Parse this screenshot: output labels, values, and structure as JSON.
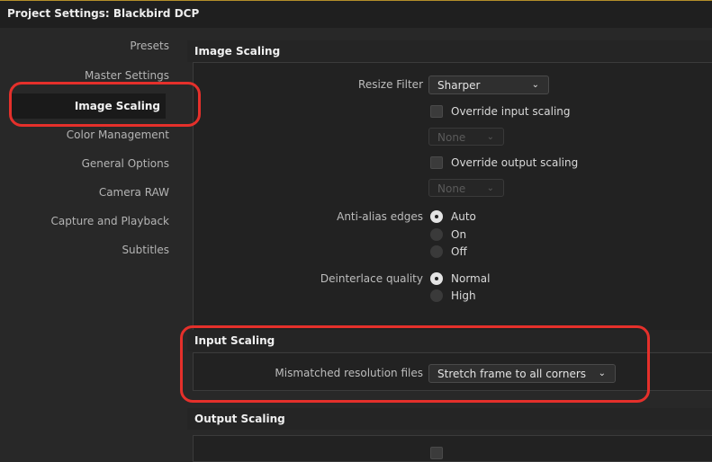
{
  "window": {
    "title": "Project Settings:  Blackbird DCP"
  },
  "sidebar": {
    "items": [
      {
        "label": "Presets"
      },
      {
        "label": "Master Settings"
      },
      {
        "label": "Image Scaling"
      },
      {
        "label": "Color Management"
      },
      {
        "label": "General Options"
      },
      {
        "label": "Camera RAW"
      },
      {
        "label": "Capture and Playback"
      },
      {
        "label": "Subtitles"
      }
    ],
    "active_index": 2
  },
  "image_scaling": {
    "header": "Image Scaling",
    "resize_filter_label": "Resize Filter",
    "resize_filter_value": "Sharper",
    "override_input_label": "Override input scaling",
    "override_input_checked": false,
    "input_select_value": "None",
    "override_output_label": "Override output scaling",
    "override_output_checked": false,
    "output_select_value": "None",
    "anti_alias_label": "Anti-alias edges",
    "anti_alias_options": [
      "Auto",
      "On",
      "Off"
    ],
    "anti_alias_selected": "Auto",
    "deinterlace_label": "Deinterlace quality",
    "deinterlace_options": [
      "Normal",
      "High"
    ],
    "deinterlace_selected": "Normal"
  },
  "input_scaling": {
    "header": "Input Scaling",
    "mismatched_label": "Mismatched resolution files",
    "mismatched_value": "Stretch frame to all corners"
  },
  "output_scaling": {
    "header": "Output Scaling"
  },
  "icons": {
    "dropdown": "chevron-down-icon"
  },
  "colors": {
    "callout": "#e5302b",
    "accent_line": "#b48f2a"
  }
}
